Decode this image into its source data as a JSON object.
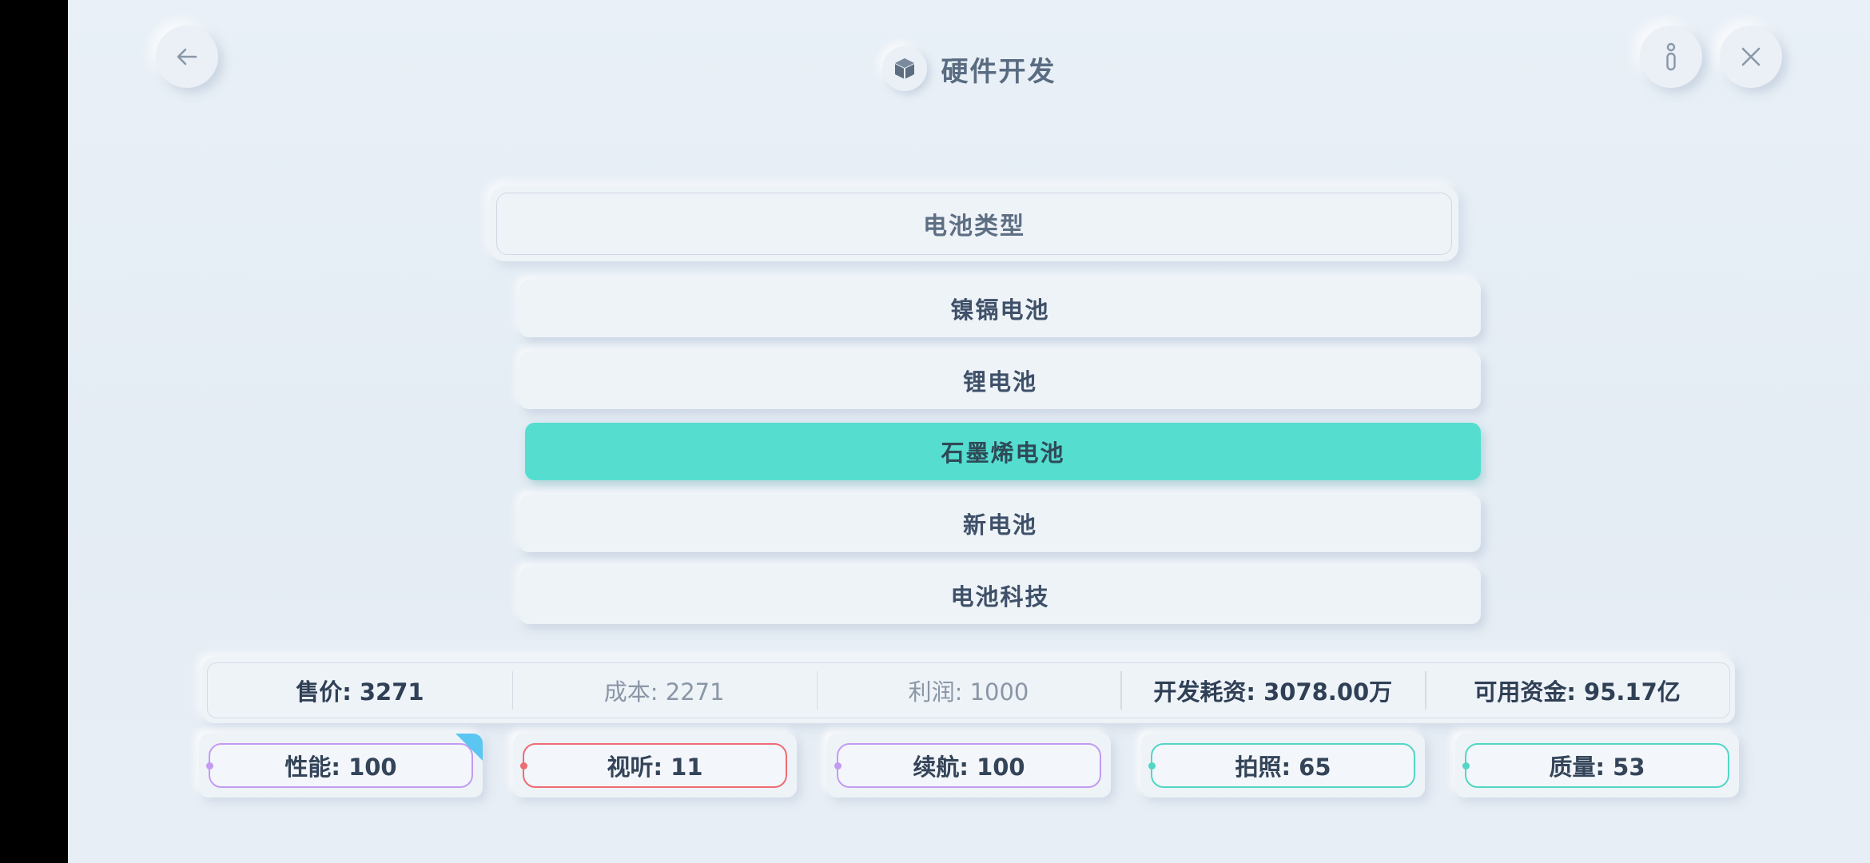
{
  "header": {
    "title": "硬件开发",
    "title_icon": "cube-icon",
    "back_icon": "arrow-left-icon",
    "info_icon": "info-icon",
    "close_icon": "close-icon"
  },
  "panel": {
    "title": "电池类型",
    "options": [
      {
        "label": "镍镉电池",
        "selected": false
      },
      {
        "label": "锂电池",
        "selected": false
      },
      {
        "label": "石墨烯电池",
        "selected": true
      },
      {
        "label": "新电池",
        "selected": false
      },
      {
        "label": "电池科技",
        "selected": false
      }
    ]
  },
  "stats": [
    {
      "label": "售价: 3271",
      "emphasis": true
    },
    {
      "label": "成本: 2271",
      "emphasis": false
    },
    {
      "label": "利润: 1000",
      "emphasis": false
    },
    {
      "label": "开发耗资: 3078.00万",
      "emphasis": true
    },
    {
      "label": "可用资金: 95.17亿",
      "emphasis": true
    }
  ],
  "attributes": [
    {
      "label": "性能: 100",
      "color": "#c39bf2",
      "tagged": true
    },
    {
      "label": "视听: 11",
      "color": "#ef6b73",
      "tagged": false
    },
    {
      "label": "续航: 100",
      "color": "#c39bf2",
      "tagged": false
    },
    {
      "label": "拍照: 65",
      "color": "#52d6c5",
      "tagged": false
    },
    {
      "label": "质量: 53",
      "color": "#52d6c5",
      "tagged": false
    }
  ],
  "colors": {
    "accent": "#55ddd0",
    "background": "#e8eef5",
    "corner_tag": "#5bc6f2"
  }
}
